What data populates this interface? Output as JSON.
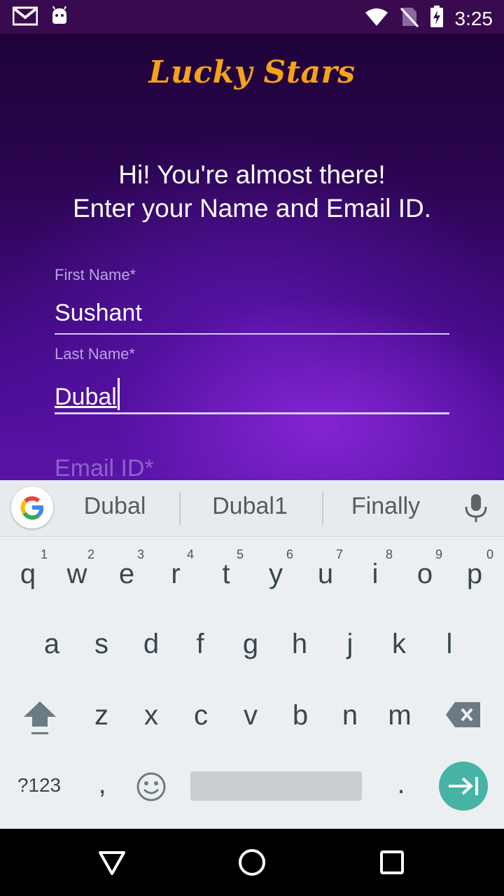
{
  "status_bar": {
    "time": "3:25",
    "icons": [
      "gmail-icon",
      "android-icon",
      "wifi-icon",
      "no-sim-icon",
      "battery-charging-icon"
    ]
  },
  "app": {
    "logo": "Lucky Stars",
    "headline_line1": "Hi! You're almost there!",
    "headline_line2": "Enter your Name and Email ID.",
    "first_name": {
      "label": "First Name*",
      "value": "Sushant"
    },
    "last_name": {
      "label": "Last Name*",
      "value": "Dubal"
    },
    "email": {
      "label": "Email ID*"
    }
  },
  "keyboard": {
    "suggestions": [
      "Dubal",
      "Dubal1",
      "Finally"
    ],
    "row1": [
      "q",
      "w",
      "e",
      "r",
      "t",
      "y",
      "u",
      "i",
      "o",
      "p"
    ],
    "row1_hints": [
      "1",
      "2",
      "3",
      "4",
      "5",
      "6",
      "7",
      "8",
      "9",
      "0"
    ],
    "row2": [
      "a",
      "s",
      "d",
      "f",
      "g",
      "h",
      "j",
      "k",
      "l"
    ],
    "row3": [
      "z",
      "x",
      "c",
      "v",
      "b",
      "n",
      "m"
    ],
    "symbols_key": "?123",
    "comma_key": ",",
    "period_key": ".",
    "accent_color": "#46b3a6"
  },
  "colors": {
    "logo": "#f5a21a",
    "background_top": "#1e0238",
    "background_bottom": "#5a14a8"
  }
}
